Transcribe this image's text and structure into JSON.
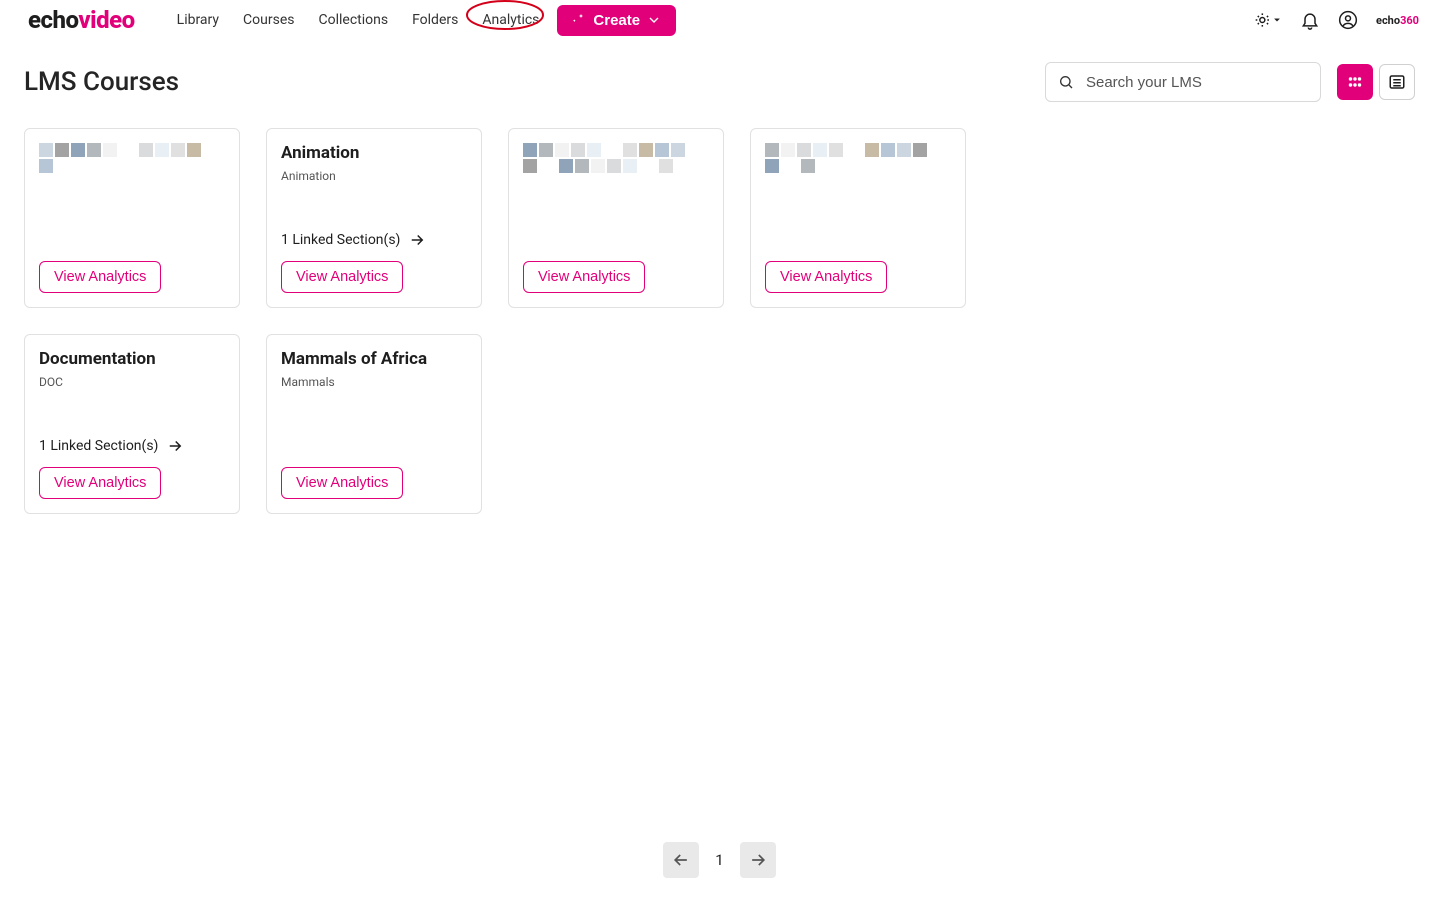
{
  "brand": {
    "echo": "echo",
    "video": "video",
    "mini360": "360"
  },
  "nav": {
    "library": "Library",
    "courses": "Courses",
    "collections": "Collections",
    "folders": "Folders",
    "analytics": "Analytics",
    "create": "Create"
  },
  "page": {
    "title": "LMS Courses"
  },
  "search": {
    "placeholder": "Search your LMS"
  },
  "cards": [
    {
      "title": "",
      "subtitle": "",
      "linked": "",
      "button": "View Analytics",
      "pixelated": true
    },
    {
      "title": "Animation",
      "subtitle": "Animation",
      "linked": "1 Linked Section(s)",
      "button": "View Analytics",
      "pixelated": false
    },
    {
      "title": "",
      "subtitle": "",
      "linked": "",
      "button": "View Analytics",
      "pixelated": true
    },
    {
      "title": "",
      "subtitle": "",
      "linked": "",
      "button": "View Analytics",
      "pixelated": true
    },
    {
      "title": "Documentation",
      "subtitle": "DOC",
      "linked": "1 Linked Section(s)",
      "button": "View Analytics",
      "pixelated": false
    },
    {
      "title": "Mammals of Africa",
      "subtitle": "Mammals",
      "linked": "",
      "button": "View Analytics",
      "pixelated": false
    }
  ],
  "pagination": {
    "current": "1"
  }
}
